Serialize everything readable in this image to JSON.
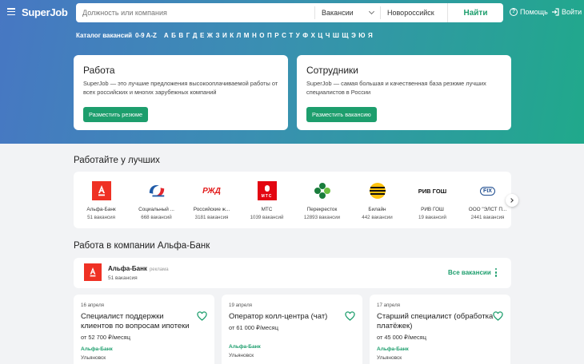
{
  "header": {
    "logo": "SuperJob",
    "search_placeholder": "Должность или компания",
    "search_type": "Вакансии",
    "city": "Новороссийск",
    "find_label": "Найти",
    "help_label": "Помощь",
    "login_label": "Войти"
  },
  "catalog": {
    "title": "Каталог вакансий",
    "alpha": "0-9 A-Z",
    "letters": [
      "А",
      "Б",
      "В",
      "Г",
      "Д",
      "Е",
      "Ж",
      "З",
      "И",
      "К",
      "Л",
      "М",
      "Н",
      "О",
      "П",
      "Р",
      "С",
      "Т",
      "У",
      "Ф",
      "Х",
      "Ц",
      "Ч",
      "Ш",
      "Щ",
      "Э",
      "Ю",
      "Я"
    ]
  },
  "hero_cards": {
    "work": {
      "title": "Работа",
      "text": "SuperJob — это лучшие предложения высокооплачиваемой работы от всех российских и многих зарубежных компаний",
      "button": "Разместить резюме"
    },
    "staff": {
      "title": "Сотрудники",
      "text": "SuperJob — самая большая и качественная база резюме лучших специалистов в России",
      "button": "Разместить вакансию"
    }
  },
  "best": {
    "title": "Работайте у лучших",
    "employers": [
      {
        "name": "Альфа-Банк",
        "count": "51 вакансия"
      },
      {
        "name": "Социальный ...",
        "count": "668 вакансий"
      },
      {
        "name": "Российские ж...",
        "count": "3181 вакансия"
      },
      {
        "name": "МТС",
        "count": "1039 вакансий"
      },
      {
        "name": "Перекресток",
        "count": "12893 вакансии"
      },
      {
        "name": "Билайн",
        "count": "442 вакансии"
      },
      {
        "name": "РИВ ГОШ",
        "count": "19 вакансий"
      },
      {
        "name": "ООО \"ЭЛСТ П...",
        "count": "2441 вакансия"
      }
    ],
    "logos": {
      "rzd": "РЖД",
      "mts": "МТС",
      "rivgosh": "РИВ ГОШ",
      "fix": "FIX"
    }
  },
  "company_section": {
    "title": "Работа в компании Альфа-Банк",
    "company_name": "Альфа-Банк",
    "ad_label": "реклама",
    "vacancies_count": "51 вакансия",
    "all_vacancies": "Все вакансии"
  },
  "vacancies": [
    {
      "date": "16 апреля",
      "title": "Специалист поддержки клиентов по вопросам ипотеки",
      "salary": "от 52 700 ₽/месяц",
      "company": "Альфа-Банк",
      "city": "Ульяновск"
    },
    {
      "date": "19 апреля",
      "title": "Оператор колл-центра (чат)",
      "salary": "от 61 000 ₽/месяц",
      "company": "Альфа-Банк",
      "city": "Ульяновск"
    },
    {
      "date": "17 апреля",
      "title": "Старший специалист (обработка платёжек)",
      "salary": "от 45 000 ₽/месяц",
      "company": "Альфа-Банк",
      "city": "Ульяновск"
    }
  ],
  "colors": {
    "accent": "#1d9e6d",
    "alfa": "#ef3124"
  }
}
